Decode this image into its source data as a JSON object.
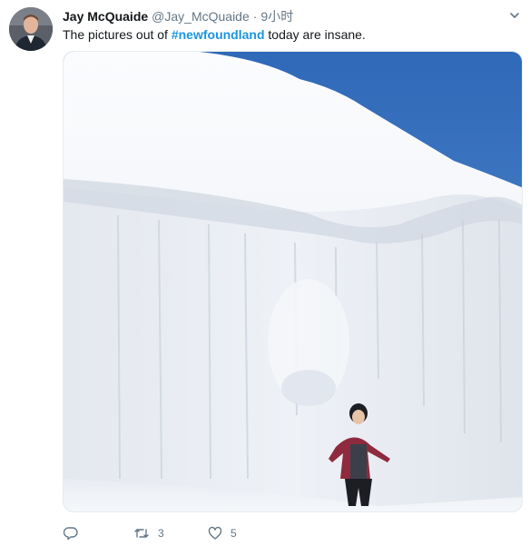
{
  "tweet": {
    "display_name": "Jay McQuaide",
    "handle": "@Jay_McQuaide",
    "separator": "·",
    "timestamp": "9小时",
    "text_before": "The pictures out of ",
    "hashtag": "#newfoundland",
    "text_after": " today are insane."
  },
  "actions": {
    "reply_count": "",
    "retweet_count": "3",
    "like_count": "5"
  },
  "icons": {
    "reply": "reply-icon",
    "retweet": "retweet-icon",
    "like": "heart-icon",
    "more": "chevron-down-icon"
  },
  "colors": {
    "hashtag": "#1b95e0",
    "secondary_text": "#657786",
    "sky": "#3f79c4"
  }
}
